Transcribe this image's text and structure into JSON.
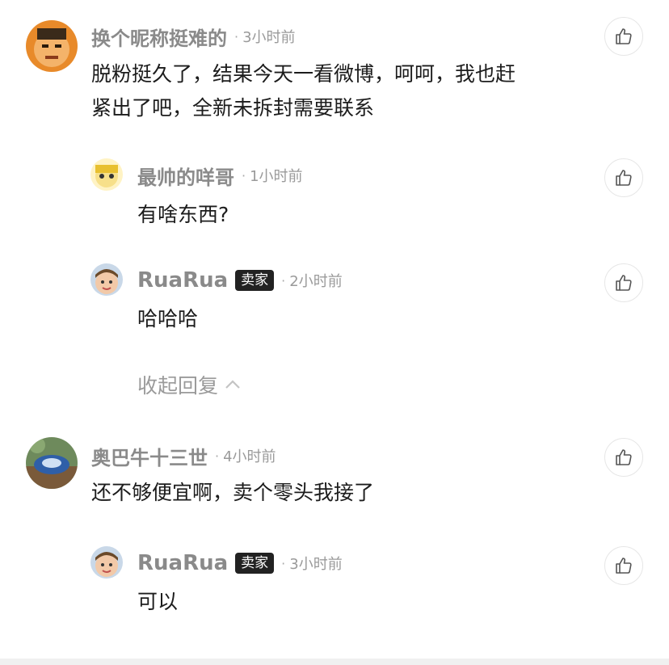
{
  "comments": [
    {
      "name": "换个昵称挺难的",
      "time": "3小时前",
      "text_lines": [
        "脱粉挺久了，结果今天一看微博，呵呵，我也赶",
        "紧出了吧，全新未拆封需要联系"
      ]
    },
    {
      "name": "最帅的咩哥",
      "time": "1小时前",
      "text_lines": [
        "有啥东西?"
      ]
    },
    {
      "name": "RuaRua",
      "badge": "卖家",
      "time": "2小时前",
      "text_lines": [
        "哈哈哈"
      ]
    },
    {
      "name": "奥巴牛十三世",
      "time": "4小时前",
      "text_lines": [
        "还不够便宜啊，卖个零头我接了"
      ]
    },
    {
      "name": "RuaRua",
      "badge": "卖家",
      "time": "3小时前",
      "text_lines": [
        "可以"
      ]
    }
  ],
  "collapse_label": "收起回复",
  "separator": "·"
}
